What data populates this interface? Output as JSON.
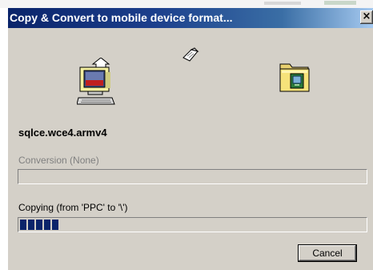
{
  "window": {
    "title": "Copy & Convert to mobile device format...",
    "close_glyph": "×"
  },
  "file": {
    "name": "sqlce.wce4.armv4"
  },
  "conversion": {
    "label": "Conversion (None)",
    "progress": 0
  },
  "copying": {
    "label": "Copying (from 'PPC' to '\\')",
    "progress": 0.11
  },
  "buttons": {
    "cancel_label": "Cancel"
  },
  "icons": {
    "source": "computer-icon",
    "moving": "document-icon",
    "destination": "folder-icon"
  },
  "colors": {
    "title_start": "#0a246a",
    "title_end": "#a6caf0",
    "face": "#d4d0c8",
    "progress_block": "#0a246a",
    "disabled_text": "#808080"
  }
}
